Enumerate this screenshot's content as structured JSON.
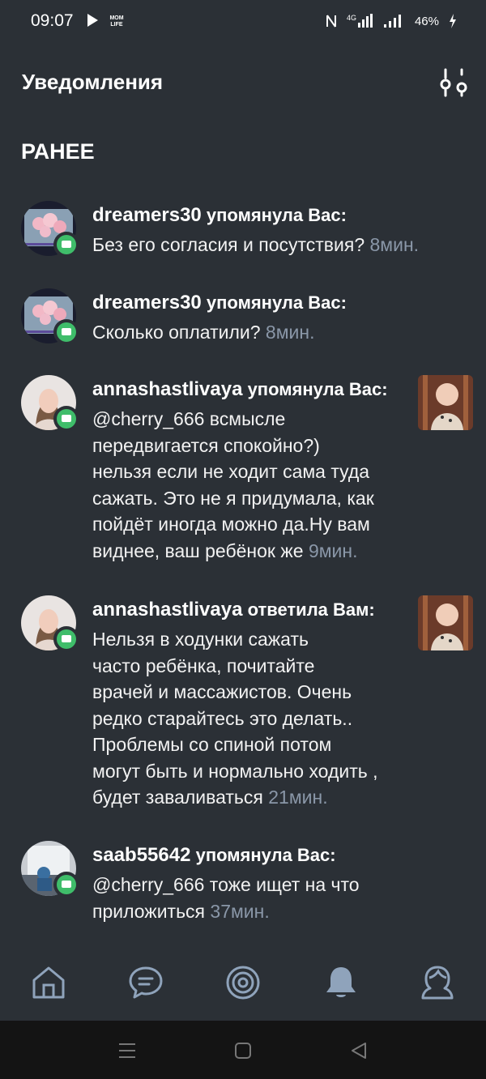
{
  "status": {
    "time": "09:07",
    "logo": "MOM LIFE",
    "battery": "46%",
    "network": "4G"
  },
  "header": {
    "title": "Уведомления"
  },
  "section": "РАНЕЕ",
  "notifications": [
    {
      "user": "dreamers30",
      "action": "упомянула Вас:",
      "text": "Без его согласия и посутствия?",
      "time": "8мин."
    },
    {
      "user": "dreamers30",
      "action": "упомянула Вас:",
      "text": "Сколько оплатили?",
      "time": "8мин."
    },
    {
      "user": "annashastlivaya",
      "action": "упомянула Вас:",
      "lines": [
        "@cherry_666 всмысле",
        "передвигается спокойно?)",
        "нельзя если не ходит сама туда",
        "сажать. Это не я придумала, как",
        "пойдёт иногда можно да.Ну вам"
      ],
      "last": "виднее, ваш ребёнок же",
      "time": "9мин."
    },
    {
      "user": "annashastlivaya",
      "action": "ответила Вам:",
      "lines": [
        "Нельзя в ходунки сажать",
        "часто ребёнка, почитайте",
        "врачей и массажистов. Очень",
        "редко старайтесь это делать..",
        "Проблемы со спиной потом",
        "могут быть и нормально ходить ,"
      ],
      "last": "будет заваливаться",
      "time": "21мин."
    },
    {
      "user": "saab55642",
      "action": "упомянула Вас:",
      "lines": [
        "@cherry_666 тоже ищет на что"
      ],
      "last": "приложиться",
      "time": "37мин."
    }
  ],
  "nav": [
    "home-icon",
    "chat-icon",
    "target-icon",
    "bell-icon",
    "profile-icon"
  ],
  "colors": {
    "background": "#2b3036",
    "badge": "#3fbd6a",
    "time": "#8a97a8"
  }
}
